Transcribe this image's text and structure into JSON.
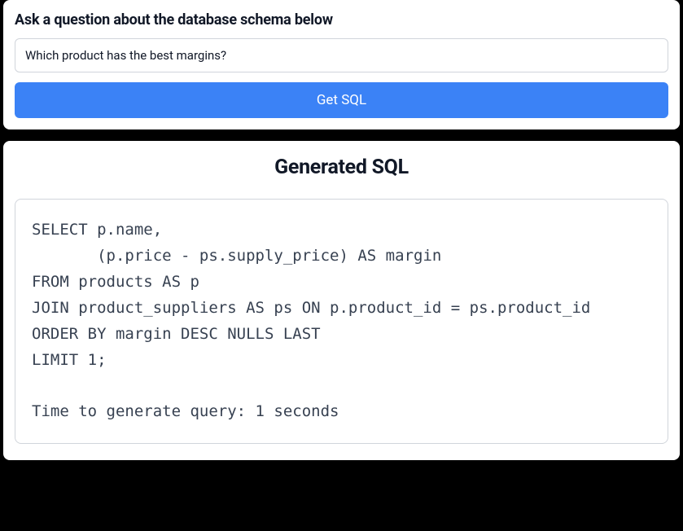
{
  "top": {
    "heading": "Ask a question about the database schema below",
    "input_value": "Which product has the best margins?",
    "button_label": "Get SQL"
  },
  "result": {
    "heading": "Generated SQL",
    "sql": "SELECT p.name,\n       (p.price - ps.supply_price) AS margin\nFROM products AS p\nJOIN product_suppliers AS ps ON p.product_id = ps.product_id\nORDER BY margin DESC NULLS LAST\nLIMIT 1;\n\nTime to generate query: 1 seconds"
  }
}
